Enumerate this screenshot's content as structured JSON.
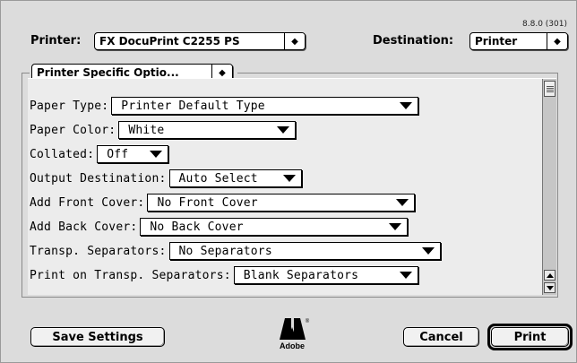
{
  "window": {
    "version": "8.8.0 (301)"
  },
  "printer": {
    "label": "Printer:",
    "value": "FX DocuPrint C2255 PS"
  },
  "destination": {
    "label": "Destination:",
    "value": "Printer"
  },
  "panel": {
    "value": "Printer Specific Optio..."
  },
  "options": [
    {
      "label": "Paper Type:",
      "value": "Printer Default Type"
    },
    {
      "label": "Paper Color:",
      "value": "White"
    },
    {
      "label": "Collated:",
      "value": "Off"
    },
    {
      "label": "Output Destination:",
      "value": "Auto Select"
    },
    {
      "label": "Add Front Cover:",
      "value": "No Front Cover"
    },
    {
      "label": "Add Back Cover:",
      "value": "No Back Cover"
    },
    {
      "label": "Transp. Separators:",
      "value": "No Separators"
    },
    {
      "label": "Print on Transp. Separators:",
      "value": "Blank Separators"
    }
  ],
  "buttons": {
    "save_settings": "Save Settings",
    "cancel": "Cancel",
    "print": "Print"
  },
  "logo": {
    "text": "Adobe",
    "mark": "®"
  },
  "icons": {
    "stepper": "up-down-arrows-icon",
    "dropdown": "triangle-down-icon",
    "scroll_up": "scroll-up-arrow-icon",
    "scroll_down": "scroll-down-arrow-icon"
  }
}
